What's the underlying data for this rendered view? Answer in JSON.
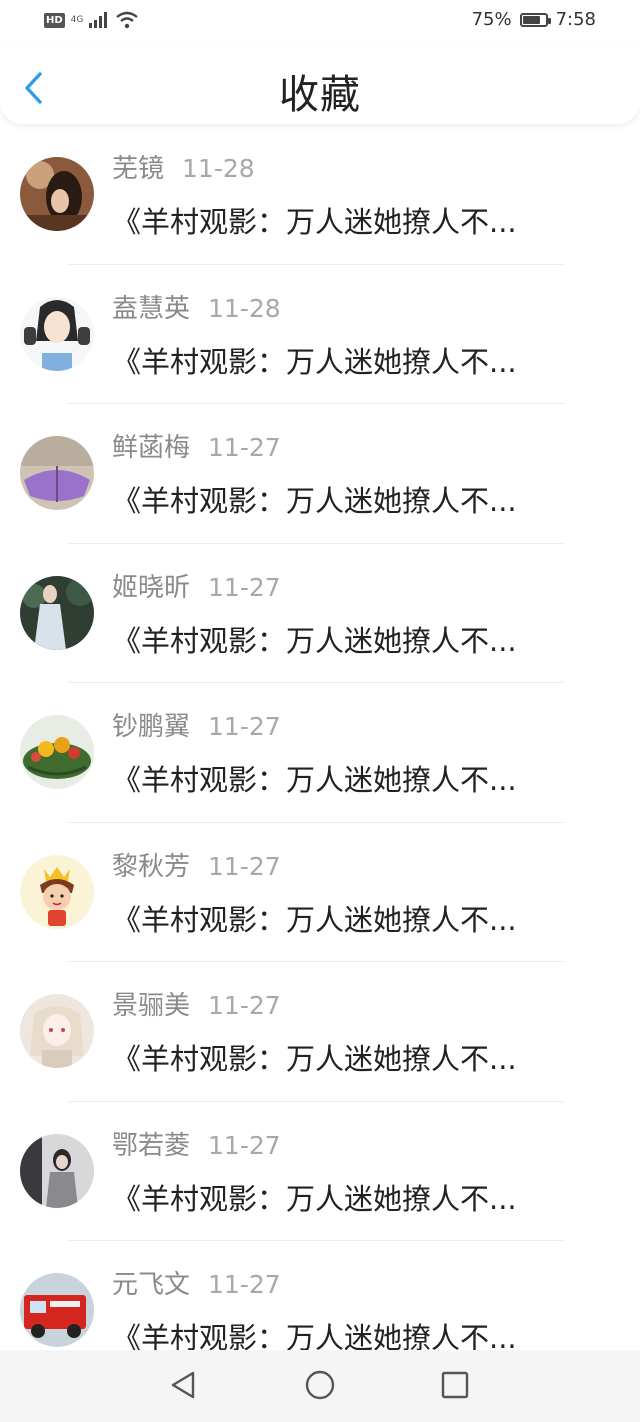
{
  "status_bar": {
    "hd": "HD",
    "network": "4G",
    "battery_text": "75%",
    "battery_level": 0.75,
    "time": "7:58"
  },
  "header": {
    "title": "收藏",
    "back_icon": "chevron-left-icon",
    "accent": "#2f9be8"
  },
  "items": [
    {
      "name": "芜镜",
      "date": "11-28",
      "title": "《羊村观影：万人迷她撩人不..."
    },
    {
      "name": "盍慧英",
      "date": "11-28",
      "title": "《羊村观影：万人迷她撩人不..."
    },
    {
      "name": "鲜菡梅",
      "date": "11-27",
      "title": "《羊村观影：万人迷她撩人不..."
    },
    {
      "name": "姬晓昕",
      "date": "11-27",
      "title": "《羊村观影：万人迷她撩人不..."
    },
    {
      "name": "钞鹏翼",
      "date": "11-27",
      "title": "《羊村观影：万人迷她撩人不..."
    },
    {
      "name": "黎秋芳",
      "date": "11-27",
      "title": "《羊村观影：万人迷她撩人不..."
    },
    {
      "name": "景骊美",
      "date": "11-27",
      "title": "《羊村观影：万人迷她撩人不..."
    },
    {
      "name": "鄂若菱",
      "date": "11-27",
      "title": "《羊村观影：万人迷她撩人不..."
    },
    {
      "name": "元飞文",
      "date": "11-27",
      "title": "《羊村观影：万人迷她撩人不..."
    }
  ],
  "bottom_nav": {
    "back_icon": "triangle-back-icon",
    "home_icon": "circle-home-icon",
    "recents_icon": "square-recents-icon"
  }
}
